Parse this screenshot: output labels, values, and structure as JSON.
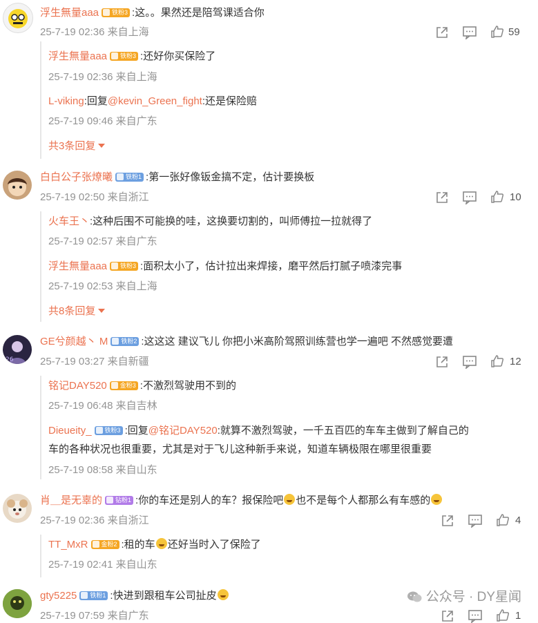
{
  "badges": {
    "tiefen3": "铁粉3",
    "tiefen1": "铁粉1",
    "tiefen2": "铁粉2",
    "jinfen3": "金粉3",
    "zuanfen1": "钻粉1",
    "jinfen2": "金粉2"
  },
  "colors": {
    "username": "#eb7350",
    "meta": "#939393",
    "badge_iron": "#6c9fe0",
    "badge_gold": "#f5a623",
    "badge_diamond": "#b17be8"
  },
  "comments": [
    {
      "user": "浮生無量aaa",
      "badge": "铁粉3",
      "text": ":这。。果然还是陪驾课适合你",
      "meta": "25-7-19 02:36 来自上海",
      "likes": "59",
      "replies": [
        {
          "user": "浮生無量aaa",
          "badge": "铁粉3",
          "text": ":还好你买保险了",
          "meta": "25-7-19 02:36 来自上海"
        },
        {
          "user": "L-viking",
          "text_prefix": ":回复",
          "mention": "@kevin_Green_fight",
          "text": ":还是保险赔",
          "meta": "25-7-19 09:46 来自广东"
        }
      ],
      "more": "共3条回复"
    },
    {
      "user": "白白公子张燎曦",
      "badge": "铁粉1",
      "text": ":第一张好像钣金搞不定，估计要换板",
      "meta": "25-7-19 02:50 来自浙江",
      "likes": "10",
      "replies": [
        {
          "user": "火车王丶",
          "text": ":这种后围不可能换的哇，这换要切割的，叫师傅拉一拉就得了",
          "meta": "25-7-19 02:57 来自广东"
        },
        {
          "user": "浮生無量aaa",
          "badge": "铁粉3",
          "text": ":面积太小了，估计拉出来焊接，磨平然后打腻子喷漆完事",
          "meta": "25-7-19 02:53 来自上海"
        }
      ],
      "more": "共8条回复"
    },
    {
      "user": "GE兮颜越丶 M",
      "badge": "铁粉2",
      "text": ":这这这 建议飞儿 你把小米高阶驾照训练营也学一遍吧 不然感觉要遭",
      "meta": "25-7-19 03:27 来自新疆",
      "likes": "12",
      "replies": [
        {
          "user": "铭记DAY520",
          "badge": "金粉3",
          "text": ":不激烈驾驶用不到的",
          "meta": "25-7-19 06:48 来自吉林"
        },
        {
          "user": "Dieueity_",
          "badge": "铁粉3",
          "text_prefix": ":回复",
          "mention": "@铭记DAY520",
          "text": ":就算不激烈驾驶，一千五百匹的车车主做到了解自己的",
          "text2": "车的各种状况也很重要，尤其是对于飞儿这种新手来说，知道车辆极限在哪里很重要",
          "meta": "25-7-19 08:58 来自山东"
        }
      ]
    },
    {
      "user": "肖＿是无辜的",
      "badge": "钻粉1",
      "text": ":你的车还是别人的车？报保险吧",
      "text_b": "也不是每个人都那么有车感的",
      "meta": "25-7-19 02:36 来自浙江",
      "likes": "4",
      "replies": [
        {
          "user": "TT_MxR",
          "badge": "金粉2",
          "text": ":租的车",
          "text_b": "还好当时入了保险了",
          "meta": "25-7-19 02:41 来自山东"
        }
      ]
    },
    {
      "user": "gty5225",
      "badge": "铁粉1",
      "text": ":快进到跟租车公司扯皮",
      "meta": "25-7-19 07:59 来自广东",
      "likes": "1"
    }
  ],
  "watermark": "公众号 · DY星闻"
}
